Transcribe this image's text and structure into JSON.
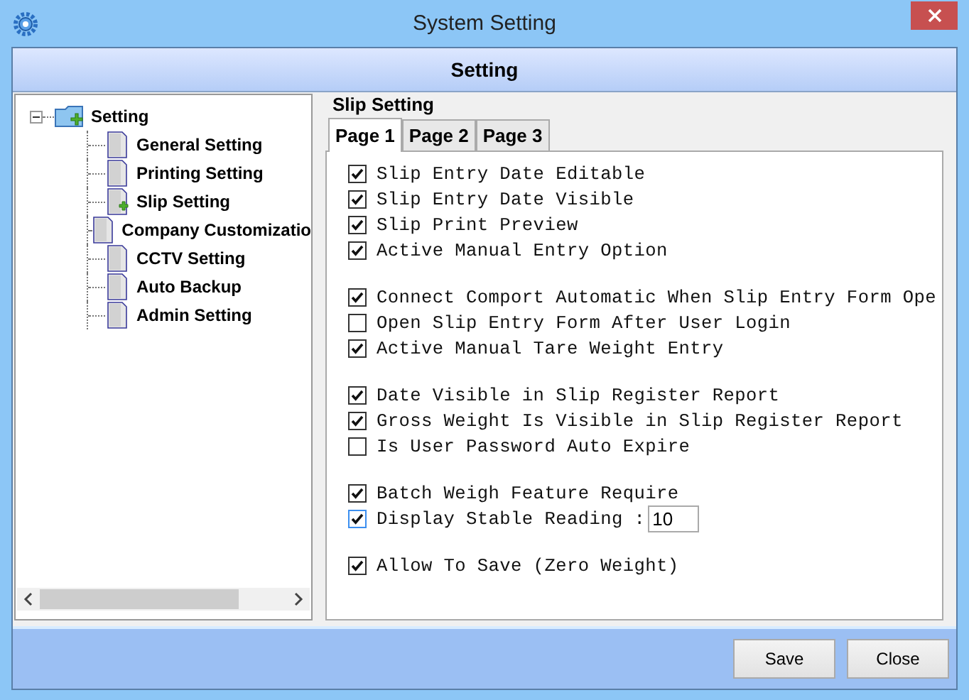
{
  "window": {
    "title": "System Setting"
  },
  "header": {
    "title": "Setting"
  },
  "tree": {
    "label": "Setting",
    "expanded": true,
    "children": [
      {
        "label": "General Setting",
        "selected": false
      },
      {
        "label": "Printing Setting",
        "selected": false
      },
      {
        "label": "Slip Setting",
        "selected": true
      },
      {
        "label": "Company Customizatio",
        "selected": false
      },
      {
        "label": "CCTV Setting",
        "selected": false
      },
      {
        "label": "Auto Backup",
        "selected": false
      },
      {
        "label": "Admin Setting",
        "selected": false
      }
    ]
  },
  "panel": {
    "title": "Slip Setting",
    "tabs": [
      {
        "label": "Page 1",
        "selected": true
      },
      {
        "label": "Page 2",
        "selected": false
      },
      {
        "label": "Page 3",
        "selected": false
      }
    ],
    "groups": [
      [
        {
          "kind": "check",
          "label": "Slip Entry Date Editable",
          "checked": true
        },
        {
          "kind": "check",
          "label": "Slip Entry Date Visible",
          "checked": true
        },
        {
          "kind": "check",
          "label": "Slip Print Preview",
          "checked": true
        },
        {
          "kind": "check",
          "label": "Active Manual Entry Option",
          "checked": true
        }
      ],
      [
        {
          "kind": "check",
          "label": "Connect Comport Automatic When Slip Entry Form Ope",
          "checked": true
        },
        {
          "kind": "check",
          "label": "Open Slip Entry Form After User Login",
          "checked": false
        },
        {
          "kind": "check",
          "label": "Active Manual Tare Weight Entry",
          "checked": true
        }
      ],
      [
        {
          "kind": "check",
          "label": "Date Visible in Slip Register Report",
          "checked": true
        },
        {
          "kind": "check",
          "label": "Gross Weight Is Visible in Slip Register Report",
          "checked": true
        },
        {
          "kind": "check",
          "label": "Is User Password Auto Expire",
          "checked": false
        }
      ],
      [
        {
          "kind": "check",
          "label": "Batch Weigh Feature Require",
          "checked": true
        },
        {
          "kind": "check_value",
          "label": "Display Stable Reading :",
          "checked": true,
          "value": "10"
        }
      ],
      [
        {
          "kind": "check",
          "label": "Allow To Save (Zero Weight)",
          "checked": true
        }
      ]
    ]
  },
  "buttons": [
    "Save",
    "Close"
  ]
}
